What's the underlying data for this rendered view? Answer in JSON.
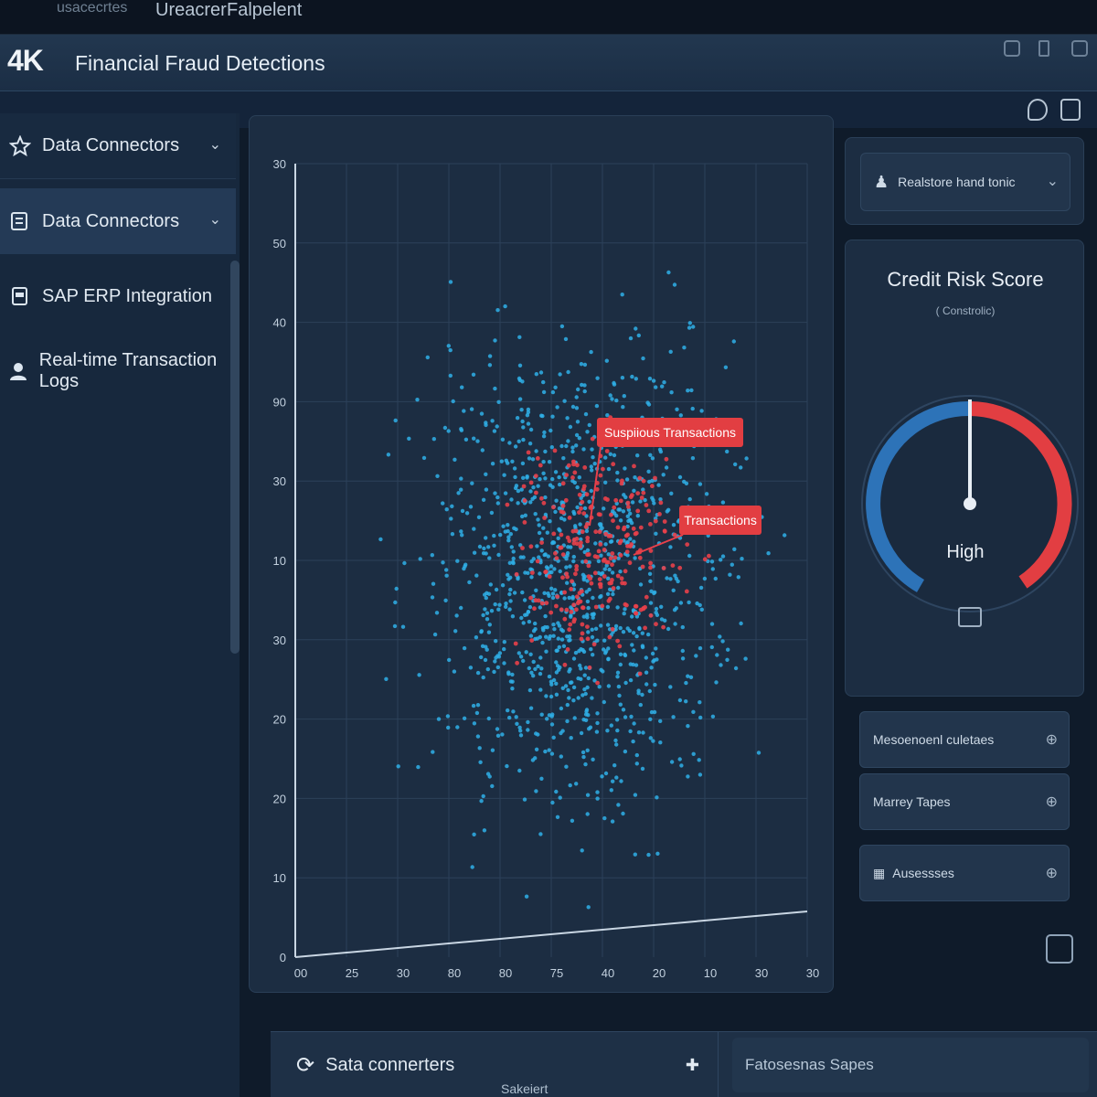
{
  "top_tabs": [
    "usacecrtes",
    "Ureacrer",
    "Falpelent"
  ],
  "logo": "4K",
  "app_title": "Financial Fraud Detections",
  "sidebar": {
    "items": [
      {
        "label": "Data Connectors",
        "icon": "star-icon"
      },
      {
        "label": "Data Connectors",
        "icon": "database-icon"
      },
      {
        "label": "SAP ERP Integration",
        "icon": "document-icon"
      },
      {
        "label": "Real-time Transaction Logs",
        "icon": "user-icon"
      }
    ]
  },
  "chart_data": {
    "type": "scatter",
    "title": "",
    "xlabel": "",
    "ylabel": "",
    "y_tick_labels": [
      "30",
      "50",
      "40",
      "90",
      "30",
      "10",
      "30",
      "20",
      "20",
      "10",
      "0"
    ],
    "x_tick_labels": [
      "00",
      "25",
      "30",
      "80",
      "80",
      "75",
      "40",
      "20",
      "10",
      "30",
      "30"
    ],
    "grid": true,
    "series": [
      {
        "name": "",
        "color": "#2fb0e8"
      },
      {
        "name": "",
        "color": "#e8404a"
      }
    ],
    "annotations": [
      {
        "text": "Suspiious Transactions"
      },
      {
        "text": "Transactions"
      }
    ]
  },
  "right": {
    "top_button": "Realstore hand tonic",
    "gauge": {
      "title": "Credit Risk Score",
      "subtitle": "( Constrolic)",
      "label": "High",
      "value_fraction": 0.5
    },
    "buttons": [
      "Mesoenoenl culetaes",
      "Marrey Tapes",
      "Ausessses"
    ]
  },
  "bottom": {
    "left_label": "Sata connerters",
    "sub_label": "Sakeiert",
    "right_label": "Fatosesnas Sapes"
  }
}
